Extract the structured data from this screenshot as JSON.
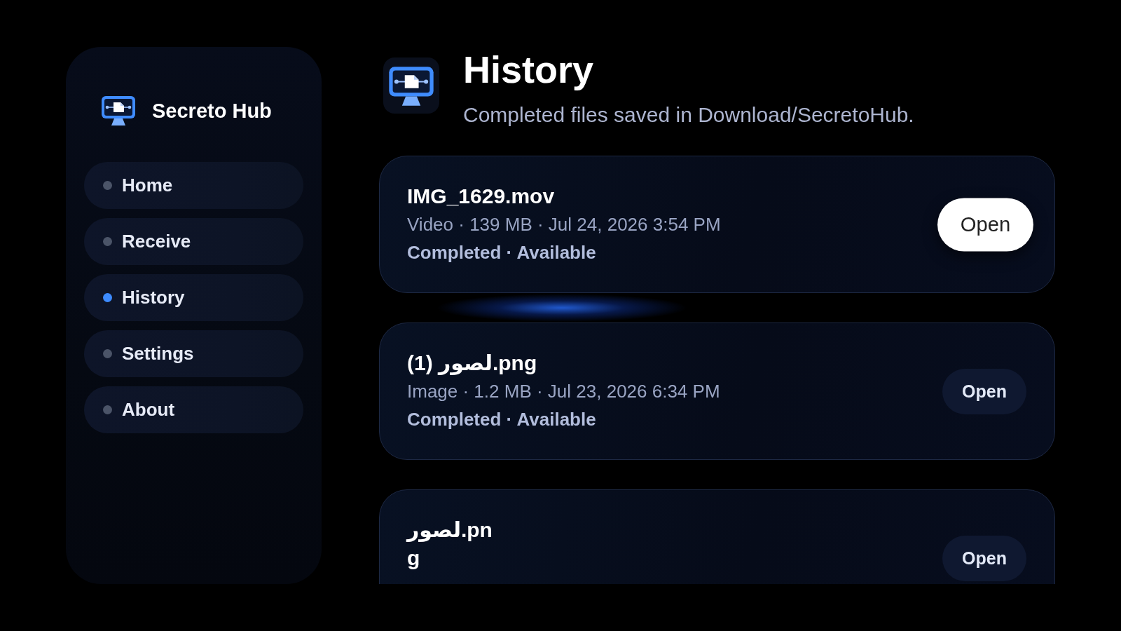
{
  "sidebar": {
    "app_name": "Secreto Hub",
    "items": [
      {
        "label": "Home",
        "selected": false
      },
      {
        "label": "Receive",
        "selected": false
      },
      {
        "label": "History",
        "selected": true
      },
      {
        "label": "Settings",
        "selected": false
      },
      {
        "label": "About",
        "selected": false
      }
    ]
  },
  "header": {
    "title": "History",
    "subtitle": "Completed files saved in Download/SecretoHub."
  },
  "items": [
    {
      "title": "IMG_1629.mov",
      "details": "Video · 139 MB · Jul 24, 2026 3:54 PM",
      "status": "Completed · Available",
      "button": "Open",
      "focused": true
    },
    {
      "title": "لصور (1).png",
      "details": "Image · 1.2 MB · Jul 23, 2026 6:34 PM",
      "status": "Completed · Available",
      "button": "Open",
      "focused": false
    },
    {
      "title": "لصور.png",
      "button": "Open",
      "focused": false
    }
  ]
}
